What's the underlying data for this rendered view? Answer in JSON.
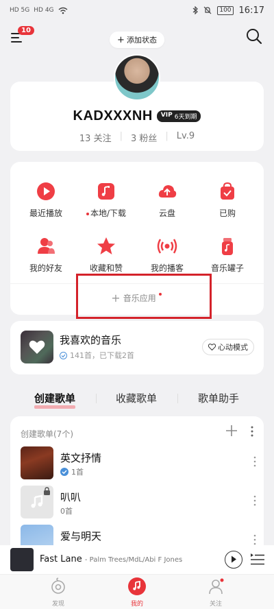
{
  "status": {
    "signal_left": "HD 5G",
    "signal_left2": "HD 4G",
    "battery": "100",
    "time": "16:17"
  },
  "topbar": {
    "badge": "10",
    "add_status": "添加状态"
  },
  "profile": {
    "name": "KADXXXNH",
    "vip_label": "VIP",
    "vip_expiry": "6天到期",
    "follow": "13 关注",
    "fans": "3 粉丝",
    "level": "Lv.9"
  },
  "grid": {
    "items": [
      {
        "label": "最近播放",
        "icon": "play-circle-icon"
      },
      {
        "label": "本地/下载",
        "icon": "music-note-icon"
      },
      {
        "label": "云盘",
        "icon": "cloud-upload-icon"
      },
      {
        "label": "已购",
        "icon": "shopping-bag-icon"
      },
      {
        "label": "我的好友",
        "icon": "friends-icon"
      },
      {
        "label": "收藏和赞",
        "icon": "star-icon"
      },
      {
        "label": "我的播客",
        "icon": "broadcast-icon"
      },
      {
        "label": "音乐罐子",
        "icon": "jar-icon"
      }
    ],
    "music_app": "音乐应用"
  },
  "liked": {
    "title": "我喜欢的音乐",
    "subtitle": "141首，已下载2首",
    "mode": "心动模式"
  },
  "tabs": [
    "创建歌单",
    "收藏歌单",
    "歌单助手"
  ],
  "playlists": {
    "header": "创建歌单(7个)",
    "items": [
      {
        "name": "英文抒情",
        "count": "1首"
      },
      {
        "name": "叭叭",
        "count": "0首"
      },
      {
        "name": "爱与明天",
        "count": ""
      }
    ]
  },
  "player": {
    "title": "Fast Lane",
    "artist": "- Palm Trees/MdL/Abi F Jones"
  },
  "nav": [
    "发现",
    "我的",
    "关注"
  ],
  "colors": {
    "accent": "#e8343a",
    "highlight_box": "#d4222a"
  }
}
